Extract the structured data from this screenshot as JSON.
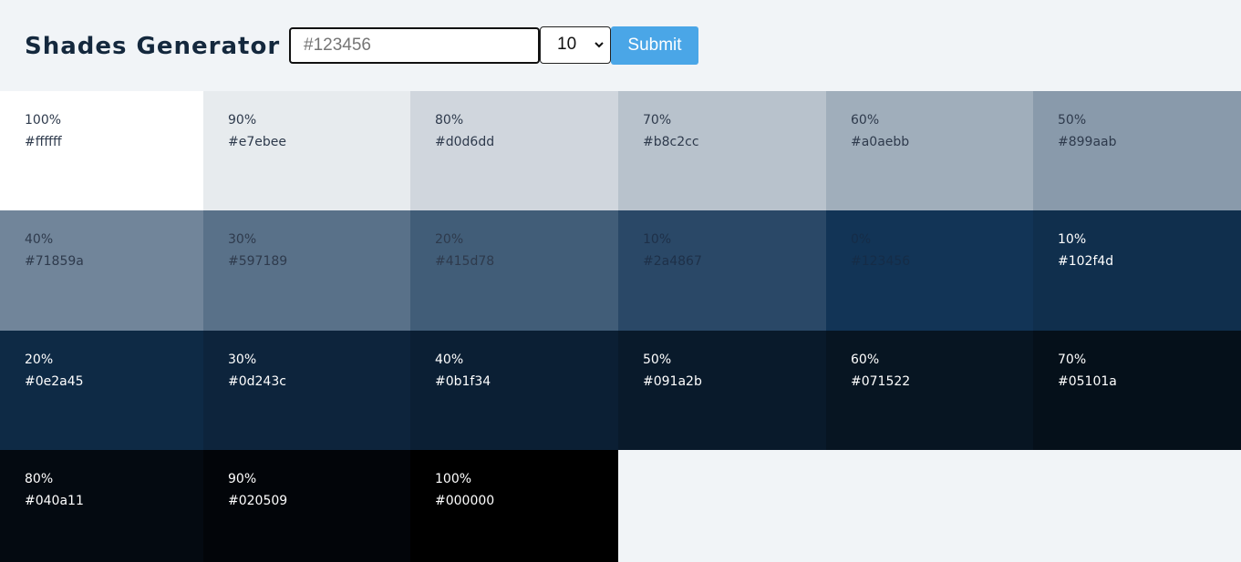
{
  "header": {
    "title": "Shades Generator",
    "input_placeholder": "#123456",
    "select_value": "10",
    "submit_label": "Submit"
  },
  "tiles": [
    {
      "percent": "100%",
      "hex": "#ffffff",
      "bg": "#ffffff",
      "fg": "#2e3a4c"
    },
    {
      "percent": "90%",
      "hex": "#e7ebee",
      "bg": "#e7ebee",
      "fg": "#2e3a4c"
    },
    {
      "percent": "80%",
      "hex": "#d0d6dd",
      "bg": "#d0d6dd",
      "fg": "#2e3a4c"
    },
    {
      "percent": "70%",
      "hex": "#b8c2cc",
      "bg": "#b8c2cc",
      "fg": "#2e3a4c"
    },
    {
      "percent": "60%",
      "hex": "#a0aebb",
      "bg": "#a0aebb",
      "fg": "#2e3a4c"
    },
    {
      "percent": "50%",
      "hex": "#899aab",
      "bg": "#899aab",
      "fg": "#2e3a4c"
    },
    {
      "percent": "40%",
      "hex": "#71859a",
      "bg": "#71859a",
      "fg": "#2e3a4c"
    },
    {
      "percent": "30%",
      "hex": "#597189",
      "bg": "#597189",
      "fg": "#2e3a4c"
    },
    {
      "percent": "20%",
      "hex": "#415d78",
      "bg": "#415d78",
      "fg": "#2e3a4c"
    },
    {
      "percent": "10%",
      "hex": "#2a4867",
      "bg": "#2a4867",
      "fg": "#1e3048"
    },
    {
      "percent": "0%",
      "hex": "#123456",
      "bg": "#123456",
      "fg": "#152c47"
    },
    {
      "percent": "10%",
      "hex": "#102f4d",
      "bg": "#102f4d",
      "fg": "#ffffff"
    },
    {
      "percent": "20%",
      "hex": "#0e2a45",
      "bg": "#0e2a45",
      "fg": "#ffffff"
    },
    {
      "percent": "30%",
      "hex": "#0d243c",
      "bg": "#0d243c",
      "fg": "#ffffff"
    },
    {
      "percent": "40%",
      "hex": "#0b1f34",
      "bg": "#0b1f34",
      "fg": "#ffffff"
    },
    {
      "percent": "50%",
      "hex": "#091a2b",
      "bg": "#091a2b",
      "fg": "#ffffff"
    },
    {
      "percent": "60%",
      "hex": "#071522",
      "bg": "#071522",
      "fg": "#ffffff"
    },
    {
      "percent": "70%",
      "hex": "#05101a",
      "bg": "#05101a",
      "fg": "#ffffff"
    },
    {
      "percent": "80%",
      "hex": "#040a11",
      "bg": "#040a11",
      "fg": "#ffffff"
    },
    {
      "percent": "90%",
      "hex": "#020509",
      "bg": "#020509",
      "fg": "#ffffff"
    },
    {
      "percent": "100%",
      "hex": "#000000",
      "bg": "#000000",
      "fg": "#ffffff"
    }
  ]
}
